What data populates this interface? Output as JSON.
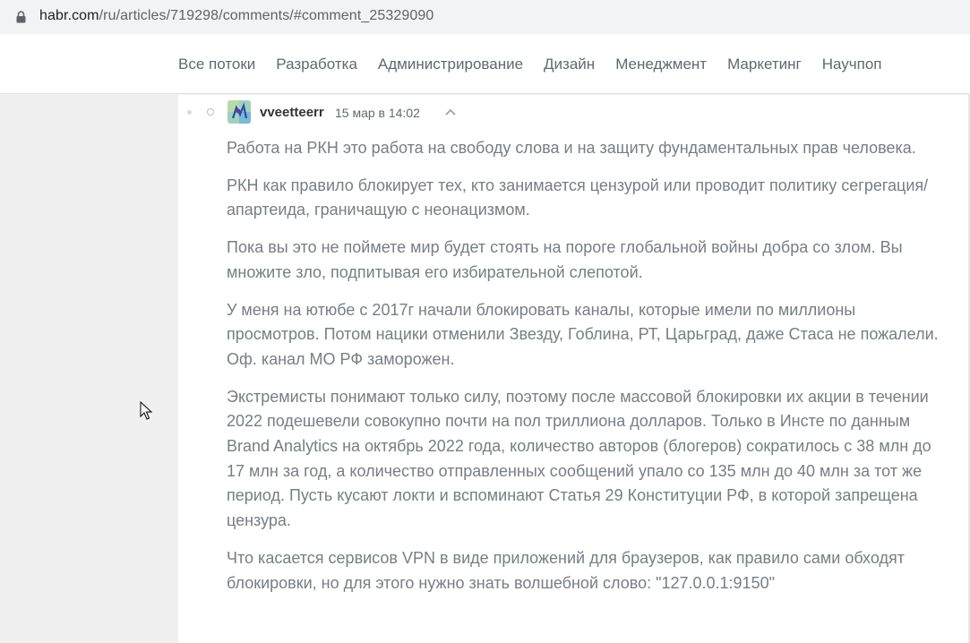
{
  "browser": {
    "url_host": "habr.com",
    "url_path": "/ru/articles/719298/comments/#comment_25329090"
  },
  "nav": {
    "items": [
      "Все потоки",
      "Разработка",
      "Администрирование",
      "Дизайн",
      "Менеджмент",
      "Маркетинг",
      "Научпоп"
    ]
  },
  "comment": {
    "username": "vveetteerr",
    "timestamp": "15 мар в 14:02",
    "paragraphs": [
      "Работа на РКН это работа на свободу слова и на защиту фундаментальных прав человека.",
      "РКН как правило блокирует тех, кто занимается цензурой или проводит политику сегрегация/апартеида, граничащую с неонацизмом.",
      "Пока вы это не поймете мир будет стоять на пороге глобальной войны добра со злом. Вы множите зло, подпитывая его избирательной слепотой.",
      "У меня на ютюбе с 2017г начали блокировать каналы, которые имели по миллионы просмотров. Потом нацики отменили Звезду, Гоблина, РТ, Царьград, даже Стаса не пожалели. Оф. канал МО РФ заморожен.",
      "Экстремисты понимают только силу, поэтому после массовой блокировки их акции в течении 2022 подешевели совокупно почти на пол триллиона долларов. Только в Инсте по данным Brand Analytics на октябрь 2022 года, количество авторов (блогеров) сократилось с 38 млн до 17 млн за год, а количество отправленных сообщений упало со 135 млн до 40 млн за тот же период.  Пусть кусают локти и вспоминают Статья 29 Конституции РФ, в которой запрещена цензура.",
      "Что касается сервисов VPN в виде приложений для браузеров, как правило сами обходят блокировки, но для этого нужно знать волшебной слово: \"127.0.0.1:9150\""
    ]
  },
  "icons": {
    "lock": "lock-icon",
    "avatar": "user-avatar",
    "chevron": "chevron-up-icon",
    "cursor": "mouse-cursor-icon"
  }
}
